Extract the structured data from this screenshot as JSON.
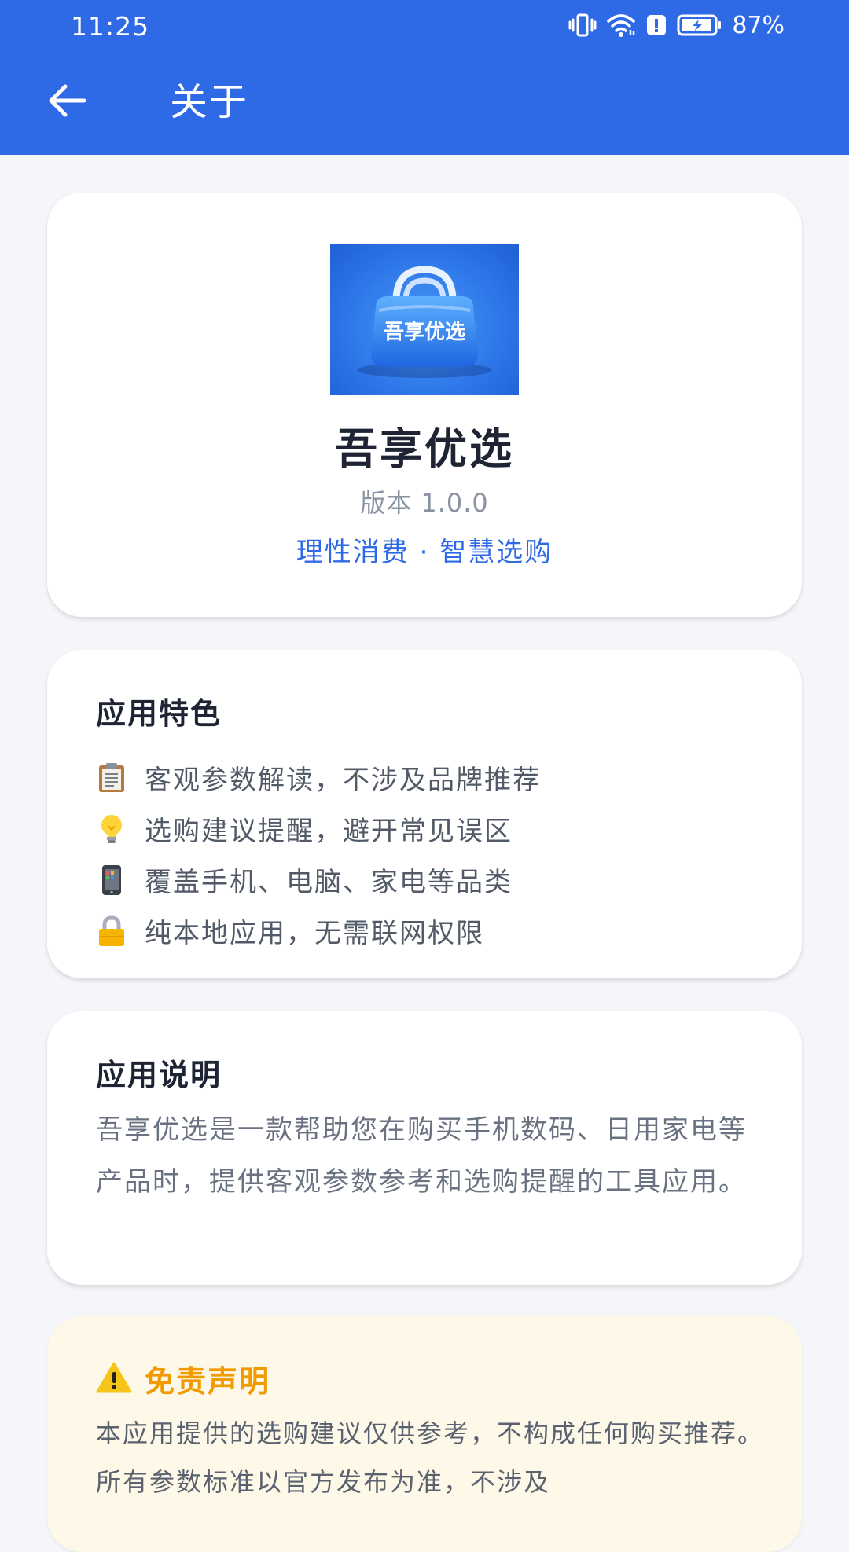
{
  "status_bar": {
    "time": "11:25",
    "battery": "87%",
    "icons": [
      "vibrate-icon",
      "wifi-icon",
      "alert-icon",
      "battery-charging-icon"
    ]
  },
  "toolbar": {
    "title": "关于",
    "back_icon": "arrow-left-icon"
  },
  "colors": {
    "primary": "#2f6ae6",
    "background": "#f4f6f9",
    "warning": "#f29b00",
    "disclaimer_bg": "#fdf8e7"
  },
  "hero": {
    "icon_text": "吾享优选",
    "app_name": "吾享优选",
    "version": "版本 1.0.0",
    "slogan": "理性消费 · 智慧选购"
  },
  "features": {
    "title": "应用特色",
    "items": [
      {
        "icon": "clipboard-icon",
        "text": "客观参数解读，不涉及品牌推荐"
      },
      {
        "icon": "lightbulb-icon",
        "text": "选购建议提醒，避开常见误区"
      },
      {
        "icon": "phone-icon",
        "text": "覆盖手机、电脑、家电等品类"
      },
      {
        "icon": "lock-icon",
        "text": "纯本地应用，无需联网权限"
      }
    ]
  },
  "description": {
    "title": "应用说明",
    "text": "吾享优选是一款帮助您在购买手机数码、日用家电等产品时，提供客观参数参考和选购提醒的工具应用。"
  },
  "disclaimer": {
    "icon": "warning-icon",
    "title": "免责声明",
    "text": "本应用提供的选购建议仅供参考，不构成任何购买推荐。所有参数标准以官方发布为准，不涉及"
  }
}
